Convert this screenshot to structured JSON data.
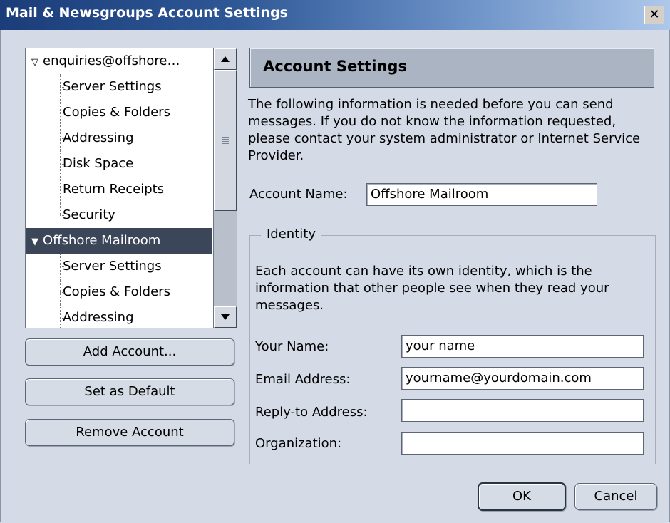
{
  "window": {
    "title": "Mail & Newsgroups Account Settings",
    "close_glyph": "✕"
  },
  "tree": {
    "items": [
      {
        "label": "enquiries@offshore…",
        "type": "account",
        "expanded": true,
        "selected": false
      },
      {
        "label": "Server Settings",
        "type": "page"
      },
      {
        "label": "Copies & Folders",
        "type": "page"
      },
      {
        "label": "Addressing",
        "type": "page"
      },
      {
        "label": "Disk Space",
        "type": "page"
      },
      {
        "label": "Return Receipts",
        "type": "page"
      },
      {
        "label": "Security",
        "type": "page"
      },
      {
        "label": "Offshore Mailroom",
        "type": "account",
        "expanded": true,
        "selected": true
      },
      {
        "label": "Server Settings",
        "type": "page"
      },
      {
        "label": "Copies & Folders",
        "type": "page"
      },
      {
        "label": "Addressing",
        "type": "page"
      }
    ]
  },
  "buttons": {
    "add_account": "Add Account...",
    "set_default": "Set as Default",
    "remove_account": "Remove Account",
    "ok": "OK",
    "cancel": "Cancel"
  },
  "panel": {
    "header": "Account Settings",
    "intro": "The following information is needed before you can send messages. If you do not know the information requested, please contact your system administrator or Internet Service Provider.",
    "account_name_label": "Account Name:",
    "account_name_value": "Offshore Mailroom",
    "identity": {
      "legend": "Identity",
      "description": "Each account can have its own identity, which is the information that other people see when they read your messages.",
      "your_name_label": "Your Name:",
      "your_name_value": "your name",
      "email_label": "Email Address:",
      "email_value": "yourname@yourdomain.com",
      "reply_to_label": "Reply-to Address:",
      "reply_to_value": "",
      "organization_label": "Organization:",
      "organization_value": ""
    }
  },
  "colors": {
    "selection": "#3b4759",
    "background": "#d4dbe6",
    "titlebar": "#1b3d7a"
  }
}
